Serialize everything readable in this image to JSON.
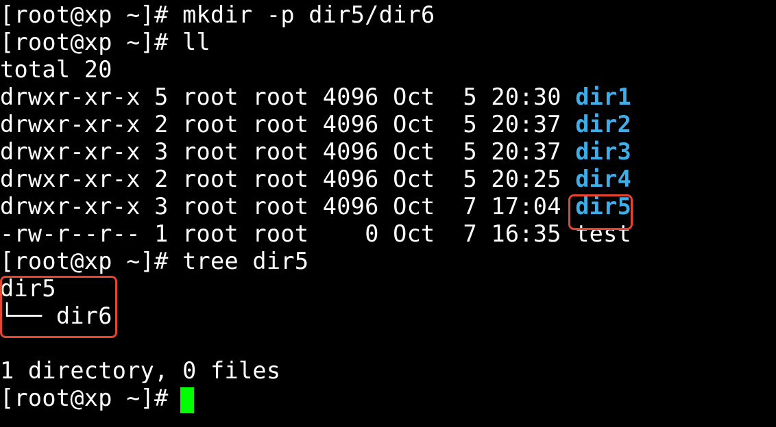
{
  "terminal": {
    "prompt": "[root@xp ~]# ",
    "lines": [
      {
        "kind": "command",
        "command": "mkdir -p dir5/dir6"
      },
      {
        "kind": "command",
        "command": "ll"
      },
      {
        "kind": "output",
        "text": "total 20"
      },
      {
        "kind": "listing",
        "perms": "drwxr-xr-x",
        "links": "5",
        "owner": "root",
        "group": "root",
        "size": "4096",
        "month": "Oct",
        "day": "5",
        "time": "20:30",
        "name": "dir1",
        "is_dir": true
      },
      {
        "kind": "listing",
        "perms": "drwxr-xr-x",
        "links": "2",
        "owner": "root",
        "group": "root",
        "size": "4096",
        "month": "Oct",
        "day": "5",
        "time": "20:37",
        "name": "dir2",
        "is_dir": true
      },
      {
        "kind": "listing",
        "perms": "drwxr-xr-x",
        "links": "3",
        "owner": "root",
        "group": "root",
        "size": "4096",
        "month": "Oct",
        "day": "5",
        "time": "20:37",
        "name": "dir3",
        "is_dir": true
      },
      {
        "kind": "listing",
        "perms": "drwxr-xr-x",
        "links": "2",
        "owner": "root",
        "group": "root",
        "size": "4096",
        "month": "Oct",
        "day": "5",
        "time": "20:25",
        "name": "dir4",
        "is_dir": true
      },
      {
        "kind": "listing",
        "perms": "drwxr-xr-x",
        "links": "3",
        "owner": "root",
        "group": "root",
        "size": "4096",
        "month": "Oct",
        "day": "7",
        "time": "17:04",
        "name": "dir5",
        "is_dir": true
      },
      {
        "kind": "listing",
        "perms": "-rw-r--r--",
        "links": "1",
        "owner": "root",
        "group": "root",
        "size": "0",
        "month": "Oct",
        "day": "7",
        "time": "16:35",
        "name": "test",
        "is_dir": false
      },
      {
        "kind": "command",
        "command": "tree dir5"
      },
      {
        "kind": "output",
        "text": "dir5"
      },
      {
        "kind": "output",
        "text": "└── dir6"
      },
      {
        "kind": "output",
        "text": ""
      },
      {
        "kind": "output",
        "text": "1 directory, 0 files"
      },
      {
        "kind": "command",
        "command": ""
      }
    ]
  },
  "colors": {
    "background": "#000000",
    "foreground": "#ffffff",
    "directory": "#3daee9",
    "cursor": "#00ff00",
    "highlight": "#e8432d"
  }
}
